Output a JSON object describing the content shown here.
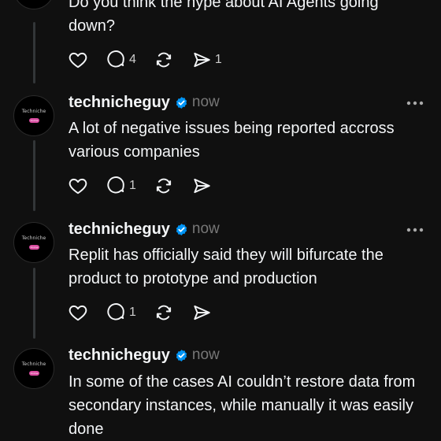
{
  "first_post": {
    "text": "Do you think the hype about AI Agents going down?",
    "reply_count": "4",
    "share_count": "1"
  },
  "posts": [
    {
      "username": "technicheguy",
      "time": "now",
      "text": "A lot of negative issues being reported accross various companies",
      "reply_count": "1",
      "avatar_text": "Techniche",
      "avatar_badge": "Online"
    },
    {
      "username": "technicheguy",
      "time": "now",
      "text": "Replit has officially said they will bifurcate the product to prototype and production",
      "reply_count": "1",
      "avatar_text": "Techniche",
      "avatar_badge": "Online"
    },
    {
      "username": "technicheguy",
      "time": "now",
      "text": "In some of the cases AI couldn’t restore data from secondary instances, while manually it was easily done",
      "avatar_text": "Techniche",
      "avatar_badge": "Online"
    }
  ],
  "colors": {
    "background": "#101010",
    "text": "#f3f5f7",
    "muted": "#777777",
    "verified": "#0095f6",
    "badge": "#d94ba0"
  }
}
